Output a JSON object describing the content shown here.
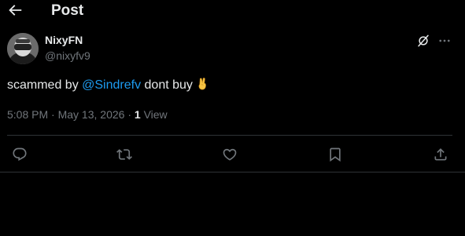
{
  "header": {
    "title": "Post",
    "back_icon": "arrow-left-icon"
  },
  "author": {
    "display_name": "NixyFN",
    "handle": "@nixyfv9",
    "avatar_icon": "avatar-image"
  },
  "header_actions": {
    "grok_icon": "grok-icon",
    "more_icon": "more-dots-icon"
  },
  "tweet": {
    "text_before": "scammed by ",
    "mention": "@Sindrefv",
    "text_after": " dont buy",
    "emoji": "victory-hand-emoji"
  },
  "meta": {
    "time": "5:08 PM",
    "separator1": " · ",
    "date": "May 13, 2026",
    "separator2": " · ",
    "views_count": "1",
    "views_label": " View"
  },
  "actions": [
    {
      "name": "reply",
      "icon": "reply-icon"
    },
    {
      "name": "repost",
      "icon": "repost-icon"
    },
    {
      "name": "like",
      "icon": "heart-icon"
    },
    {
      "name": "bookmark",
      "icon": "bookmark-icon"
    },
    {
      "name": "share",
      "icon": "share-icon"
    }
  ],
  "colors": {
    "background": "#000000",
    "text_primary": "#e7e9ea",
    "text_secondary": "#71767b",
    "accent": "#1d9bf0",
    "divider": "#2f3336"
  }
}
